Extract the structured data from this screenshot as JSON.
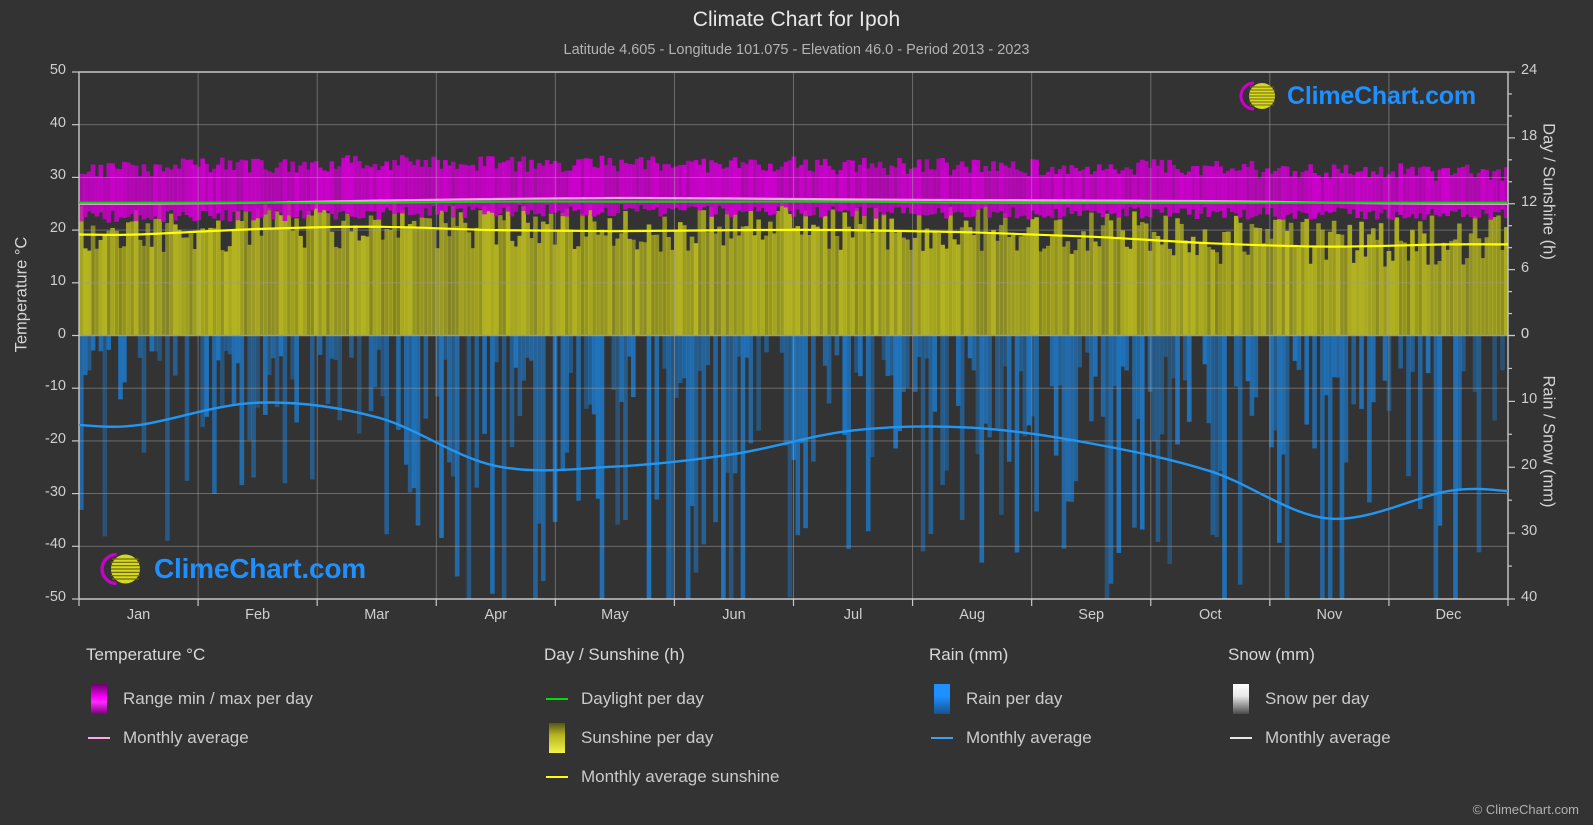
{
  "header": {
    "title": "Climate Chart for Ipoh",
    "subtitle": "Latitude 4.605 - Longitude 101.075 - Elevation 46.0 - Period 2013 - 2023"
  },
  "branding": {
    "watermark_text": "ClimeChart.com",
    "copyright": "© ClimeChart.com"
  },
  "axes": {
    "left_title": "Temperature °C",
    "right_top_title": "Day / Sunshine (h)",
    "right_bottom_title": "Rain / Snow (mm)",
    "left_ticks": [
      "50",
      "40",
      "30",
      "20",
      "10",
      "0",
      "-10",
      "-20",
      "-30",
      "-40",
      "-50"
    ],
    "right_top_ticks": [
      "24",
      "18",
      "12",
      "6",
      "0"
    ],
    "right_bottom_ticks": [
      "0",
      "10",
      "20",
      "30",
      "40"
    ],
    "months": [
      "Jan",
      "Feb",
      "Mar",
      "Apr",
      "May",
      "Jun",
      "Jul",
      "Aug",
      "Sep",
      "Oct",
      "Nov",
      "Dec"
    ]
  },
  "legend": {
    "temperature": {
      "heading": "Temperature °C",
      "items": [
        {
          "label": "Range min / max per day",
          "key": "swatch",
          "color": "#ff00ff"
        },
        {
          "label": "Monthly average",
          "key": "line",
          "color": "#ffa8e8"
        }
      ]
    },
    "day_sunshine": {
      "heading": "Day / Sunshine (h)",
      "items": [
        {
          "label": "Daylight per day",
          "key": "line",
          "color": "#00e000"
        },
        {
          "label": "Sunshine per day",
          "key": "swatch",
          "color": "#f2f24d"
        },
        {
          "label": "Monthly average sunshine",
          "key": "line",
          "color": "#ffff00"
        }
      ]
    },
    "rain": {
      "heading": "Rain (mm)",
      "items": [
        {
          "label": "Rain per day",
          "key": "swatch",
          "color": "#1e90ff"
        },
        {
          "label": "Monthly average",
          "key": "line",
          "color": "#3ea0f0"
        }
      ]
    },
    "snow": {
      "heading": "Snow (mm)",
      "items": [
        {
          "label": "Snow per day",
          "key": "swatch",
          "color": "#e8e8e8"
        },
        {
          "label": "Monthly average",
          "key": "line",
          "color": "#e8e8e8"
        }
      ]
    }
  },
  "colors": {
    "background": "#333333",
    "grid": "#9a9a9a",
    "temp_band": "#cc00cc",
    "temp_avg_line": "#ff9ee8",
    "sunshine_band": "#b5b521",
    "sunshine_avg_line": "#ffff00",
    "daylight_line": "#00dd00",
    "rain_band": "#1f77c4",
    "rain_avg_line": "#2196f3"
  },
  "chart_data": {
    "type": "area",
    "title": "Climate Chart for Ipoh",
    "subtitle": "Latitude 4.605 - Longitude 101.075 - Elevation 46.0 - Period 2013 - 2023",
    "xlabel": "",
    "categories": [
      "Jan",
      "Feb",
      "Mar",
      "Apr",
      "May",
      "Jun",
      "Jul",
      "Aug",
      "Sep",
      "Oct",
      "Nov",
      "Dec"
    ],
    "axis_left": {
      "label": "Temperature °C",
      "ylim": [
        -50,
        50
      ],
      "ticks": [
        50,
        40,
        30,
        20,
        10,
        0,
        -10,
        -20,
        -30,
        -40,
        -50
      ]
    },
    "axis_right_top": {
      "label": "Day / Sunshine (h)",
      "ylim": [
        0,
        24
      ],
      "ticks": [
        24,
        18,
        12,
        6,
        0
      ]
    },
    "axis_right_bottom": {
      "label": "Rain / Snow (mm)",
      "ylim": [
        0,
        40
      ],
      "ticks": [
        0,
        10,
        20,
        30,
        40
      ]
    },
    "grid": true,
    "legend_position": "below",
    "series": [
      {
        "name": "Monthly average temperature",
        "axis": "left",
        "unit": "°C",
        "color": "#ff9ee8",
        "values": [
          25.0,
          25.2,
          25.6,
          25.9,
          26.1,
          26.0,
          25.8,
          25.7,
          25.6,
          25.5,
          25.2,
          25.0
        ]
      },
      {
        "name": "Daily max temperature (band top)",
        "axis": "left",
        "unit": "°C",
        "color": "#cc00cc",
        "values": [
          31.5,
          32.3,
          32.6,
          32.5,
          32.4,
          32.2,
          32.0,
          31.9,
          31.7,
          31.5,
          31.0,
          30.8
        ]
      },
      {
        "name": "Daily min temperature (band bottom)",
        "axis": "left",
        "unit": "°C",
        "color": "#cc00cc",
        "values": [
          22.6,
          22.7,
          23.1,
          23.6,
          23.8,
          23.6,
          23.3,
          23.2,
          23.2,
          23.2,
          23.1,
          22.9
        ]
      },
      {
        "name": "Daylight per day",
        "axis": "right_top",
        "unit": "h",
        "color": "#00dd00",
        "values": [
          12.1,
          12.1,
          12.1,
          12.2,
          12.2,
          12.2,
          12.2,
          12.1,
          12.1,
          12.1,
          12.1,
          12.1
        ]
      },
      {
        "name": "Monthly average sunshine",
        "axis": "right_top",
        "unit": "h",
        "color": "#ffff00",
        "values": [
          9.2,
          9.7,
          9.9,
          9.6,
          9.5,
          9.6,
          9.6,
          9.4,
          9.0,
          8.4,
          8.1,
          8.3
        ]
      },
      {
        "name": "Sunshine per day (band)",
        "axis": "right_top",
        "unit": "h",
        "color": "#b5b521",
        "values": [
          9.2,
          9.7,
          9.9,
          9.6,
          9.5,
          9.6,
          9.6,
          9.4,
          9.0,
          8.4,
          8.1,
          8.3
        ]
      },
      {
        "name": "Monthly average rain",
        "axis": "right_bottom",
        "unit": "mm",
        "color": "#2196f3",
        "values": [
          13.6,
          10.2,
          12.4,
          19.8,
          19.9,
          18.0,
          14.4,
          14.0,
          16.4,
          20.6,
          27.8,
          23.6
        ]
      },
      {
        "name": "Monthly average snow",
        "axis": "right_bottom",
        "unit": "mm",
        "color": "#e8e8e8",
        "values": [
          0,
          0,
          0,
          0,
          0,
          0,
          0,
          0,
          0,
          0,
          0,
          0
        ]
      }
    ]
  }
}
